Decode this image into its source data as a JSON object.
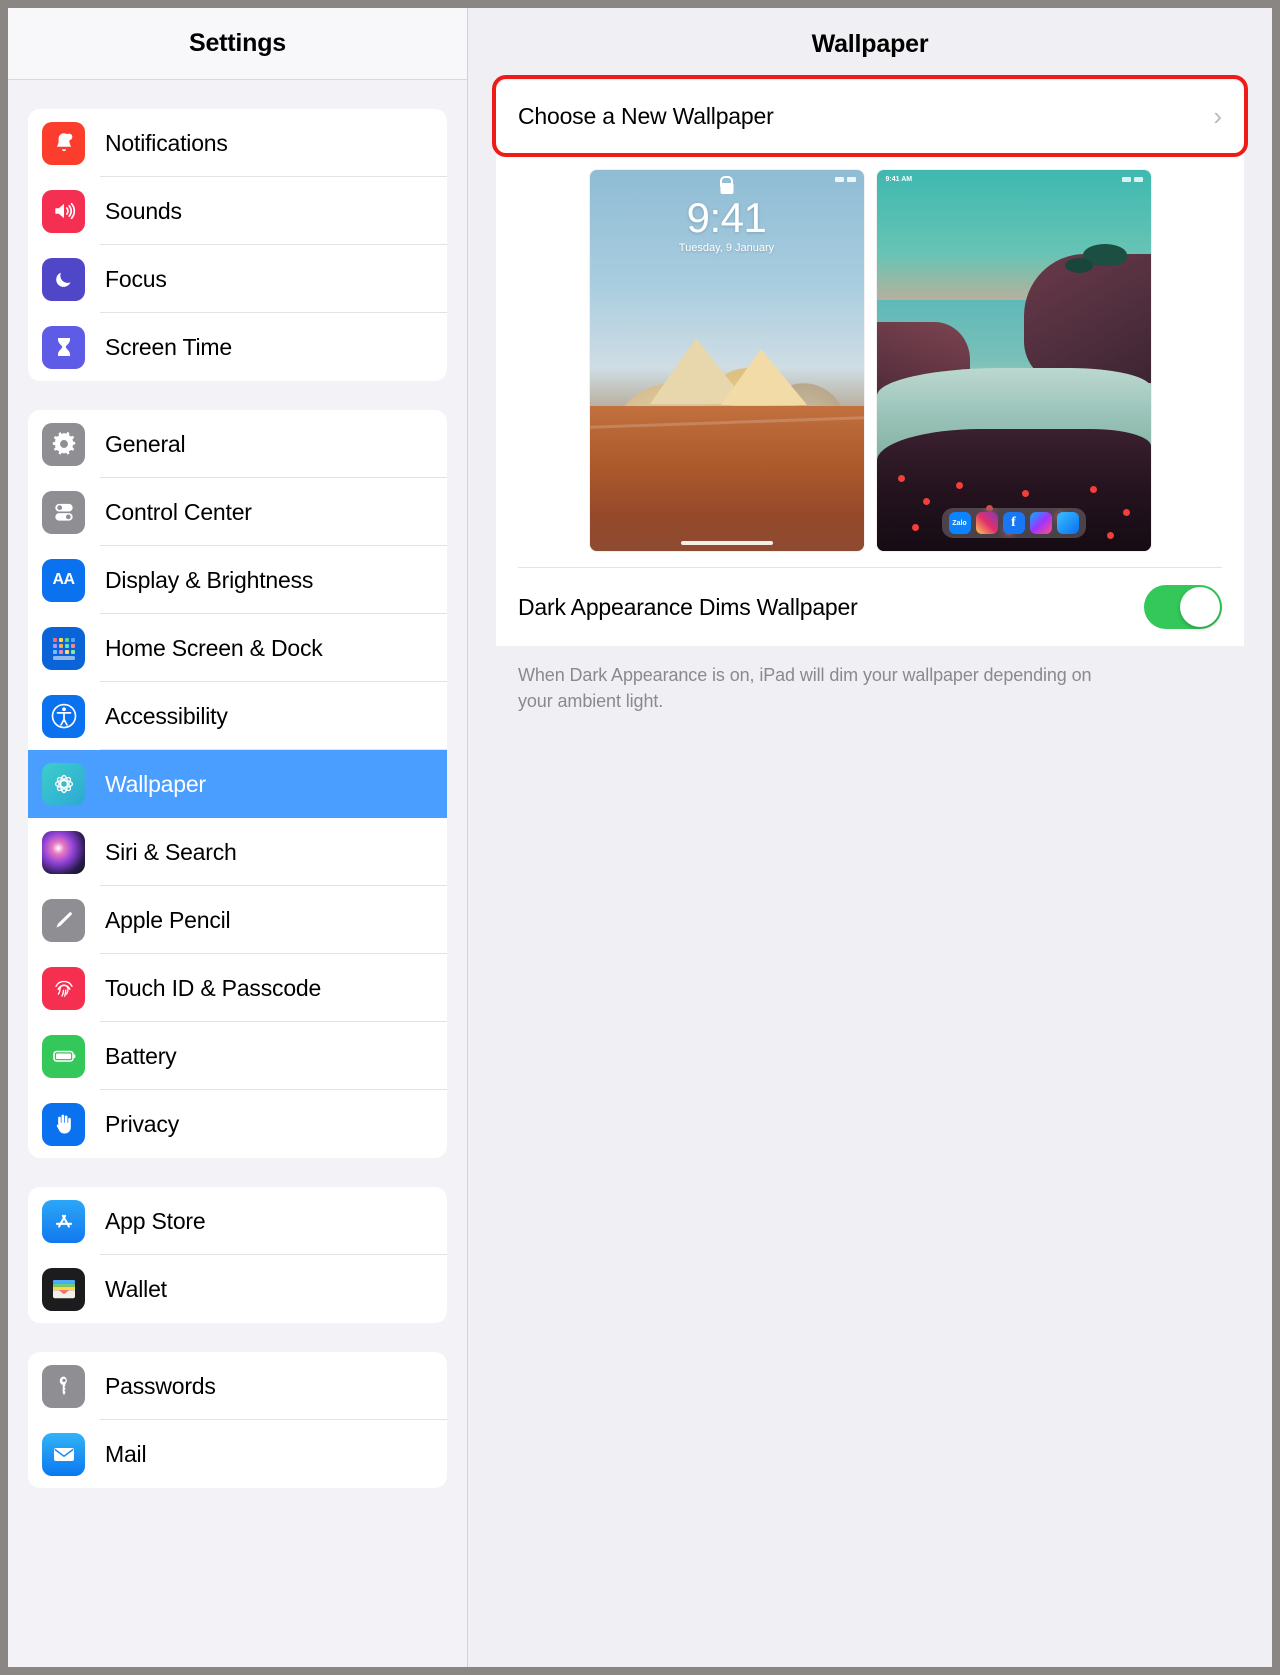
{
  "sidebar": {
    "title": "Settings",
    "groups": [
      {
        "items": [
          {
            "label": "Notifications",
            "icon": "notifications-icon",
            "selected": false
          },
          {
            "label": "Sounds",
            "icon": "sounds-icon",
            "selected": false
          },
          {
            "label": "Focus",
            "icon": "focus-icon",
            "selected": false
          },
          {
            "label": "Screen Time",
            "icon": "screen-time-icon",
            "selected": false
          }
        ]
      },
      {
        "items": [
          {
            "label": "General",
            "icon": "gear-icon",
            "selected": false
          },
          {
            "label": "Control Center",
            "icon": "control-center-icon",
            "selected": false
          },
          {
            "label": "Display & Brightness",
            "icon": "display-icon",
            "selected": false
          },
          {
            "label": "Home Screen & Dock",
            "icon": "home-screen-icon",
            "selected": false
          },
          {
            "label": "Accessibility",
            "icon": "accessibility-icon",
            "selected": false
          },
          {
            "label": "Wallpaper",
            "icon": "wallpaper-icon",
            "selected": true
          },
          {
            "label": "Siri & Search",
            "icon": "siri-icon",
            "selected": false
          },
          {
            "label": "Apple Pencil",
            "icon": "pencil-icon",
            "selected": false
          },
          {
            "label": "Touch ID & Passcode",
            "icon": "fingerprint-icon",
            "selected": false
          },
          {
            "label": "Battery",
            "icon": "battery-icon",
            "selected": false
          },
          {
            "label": "Privacy",
            "icon": "hand-icon",
            "selected": false
          }
        ]
      },
      {
        "items": [
          {
            "label": "App Store",
            "icon": "app-store-icon",
            "selected": false
          },
          {
            "label": "Wallet",
            "icon": "wallet-icon",
            "selected": false
          }
        ]
      },
      {
        "items": [
          {
            "label": "Passwords",
            "icon": "key-icon",
            "selected": false
          },
          {
            "label": "Mail",
            "icon": "mail-icon",
            "selected": false
          }
        ]
      }
    ]
  },
  "detail": {
    "title": "Wallpaper",
    "choose_new_wallpaper": {
      "label": "Choose a New Wallpaper",
      "chevron": "›",
      "highlighted": true,
      "highlight_color": "#ef1b16"
    },
    "previews": {
      "lock_screen": {
        "name": "lock-screen-preview",
        "time": "9:41",
        "date": "Tuesday, 9 January",
        "lock_icon": "lock-icon"
      },
      "home_screen": {
        "name": "home-screen-preview",
        "status_time": "9:41 AM",
        "dock_apps": [
          {
            "name": "zalo-app-icon",
            "label": "Zalo"
          },
          {
            "name": "instagram-app-icon",
            "label": ""
          },
          {
            "name": "facebook-app-icon",
            "label": "f"
          },
          {
            "name": "messenger-app-icon",
            "label": ""
          },
          {
            "name": "safari-app-icon",
            "label": ""
          }
        ]
      }
    },
    "dark_appearance": {
      "label": "Dark Appearance Dims Wallpaper",
      "enabled": true,
      "on_color": "#34c759"
    },
    "footer_note": "When Dark Appearance is on, iPad will dim your wallpaper depending on your ambient light."
  }
}
